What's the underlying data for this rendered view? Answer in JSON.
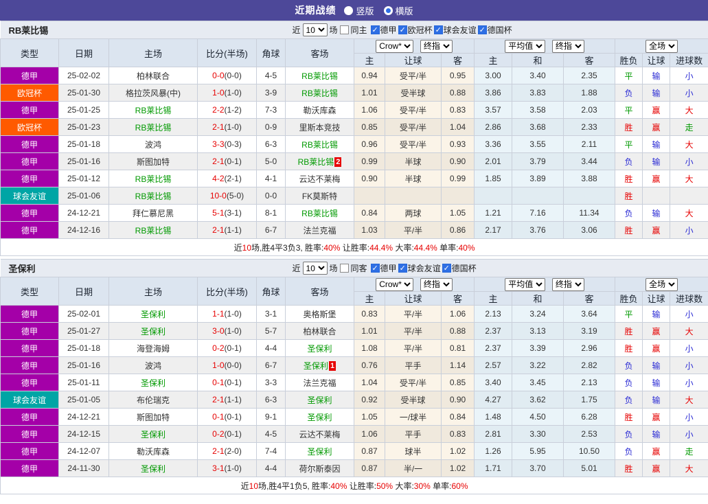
{
  "topbar": {
    "title": "近期战绩",
    "vertical_label": "竖版",
    "horizontal_label": "横版"
  },
  "controls": {
    "near_label": "近",
    "count": "10",
    "matches_label": "场"
  },
  "columns": {
    "main": [
      "类型",
      "日期",
      "主场",
      "比分(半场)",
      "角球",
      "客场"
    ],
    "sub": [
      "主",
      "让球",
      "客",
      "主",
      "和",
      "客",
      "胜负",
      "让球",
      "进球数"
    ],
    "dropdowns": {
      "crow": "Crow*",
      "final1": "终指",
      "avg": "平均值",
      "final2": "终指",
      "scope": "全场"
    }
  },
  "colors": {
    "accent_purple": "#4d4899",
    "league_purple": "#a400a8",
    "league_orange": "#ff5a00",
    "league_teal": "#00a5a5",
    "win_red": "#e60000",
    "lose_blue": "#2a2ad4",
    "draw_green": "#009900"
  },
  "tables": [
    {
      "team": "RB莱比锡",
      "same_label": "同主",
      "leagues": [
        "德甲",
        "欧冠杯",
        "球会友谊",
        "德国杯"
      ],
      "rows": [
        {
          "type": "德甲",
          "type_cls": "purple",
          "date": "25-02-02",
          "home": "柏林联合",
          "home_focus": false,
          "score": "0-0",
          "half": "(0-0)",
          "corner": "4-5",
          "away": "RB莱比锡",
          "away_focus": true,
          "badge": "",
          "c0": "0.94",
          "c1": "受平/半",
          "c2": "0.95",
          "a0": "3.00",
          "a1": "3.40",
          "a2": "2.35",
          "r0": "平",
          "k0": "g",
          "r1": "输",
          "k1": "b",
          "r2": "小",
          "k2": "b"
        },
        {
          "type": "欧冠杯",
          "type_cls": "orange",
          "date": "25-01-30",
          "home": "格拉茨风暴(中)",
          "home_focus": false,
          "score": "1-0",
          "half": "(1-0)",
          "corner": "3-9",
          "away": "RB莱比锡",
          "away_focus": true,
          "badge": "",
          "c0": "1.01",
          "c1": "受半球",
          "c2": "0.88",
          "a0": "3.86",
          "a1": "3.83",
          "a2": "1.88",
          "r0": "负",
          "k0": "b",
          "r1": "输",
          "k1": "b",
          "r2": "小",
          "k2": "b"
        },
        {
          "type": "德甲",
          "type_cls": "purple",
          "date": "25-01-25",
          "home": "RB莱比锡",
          "home_focus": true,
          "score": "2-2",
          "half": "(1-2)",
          "corner": "7-3",
          "away": "勒沃库森",
          "away_focus": false,
          "badge": "",
          "c0": "1.06",
          "c1": "受平/半",
          "c2": "0.83",
          "a0": "3.57",
          "a1": "3.58",
          "a2": "2.03",
          "r0": "平",
          "k0": "g",
          "r1": "赢",
          "k1": "r",
          "r2": "大",
          "k2": "r"
        },
        {
          "type": "欧冠杯",
          "type_cls": "orange",
          "date": "25-01-23",
          "home": "RB莱比锡",
          "home_focus": true,
          "score": "2-1",
          "half": "(1-0)",
          "corner": "0-9",
          "away": "里斯本竞技",
          "away_focus": false,
          "badge": "",
          "c0": "0.85",
          "c1": "受平/半",
          "c2": "1.04",
          "a0": "2.86",
          "a1": "3.68",
          "a2": "2.33",
          "r0": "胜",
          "k0": "r",
          "r1": "赢",
          "k1": "r",
          "r2": "走",
          "k2": "g"
        },
        {
          "type": "德甲",
          "type_cls": "purple",
          "date": "25-01-18",
          "home": "波鸿",
          "home_focus": false,
          "score": "3-3",
          "half": "(0-3)",
          "corner": "6-3",
          "away": "RB莱比锡",
          "away_focus": true,
          "badge": "",
          "c0": "0.96",
          "c1": "受平/半",
          "c2": "0.93",
          "a0": "3.36",
          "a1": "3.55",
          "a2": "2.11",
          "r0": "平",
          "k0": "g",
          "r1": "输",
          "k1": "b",
          "r2": "大",
          "k2": "r"
        },
        {
          "type": "德甲",
          "type_cls": "purple",
          "date": "25-01-16",
          "home": "斯图加特",
          "home_focus": false,
          "score": "2-1",
          "half": "(0-1)",
          "corner": "5-0",
          "away": "RB莱比锡",
          "away_focus": true,
          "badge": "2",
          "c0": "0.99",
          "c1": "半球",
          "c2": "0.90",
          "a0": "2.01",
          "a1": "3.79",
          "a2": "3.44",
          "r0": "负",
          "k0": "b",
          "r1": "输",
          "k1": "b",
          "r2": "小",
          "k2": "b"
        },
        {
          "type": "德甲",
          "type_cls": "purple",
          "date": "25-01-12",
          "home": "RB莱比锡",
          "home_focus": true,
          "score": "4-2",
          "half": "(2-1)",
          "corner": "4-1",
          "away": "云达不莱梅",
          "away_focus": false,
          "badge": "",
          "c0": "0.90",
          "c1": "半球",
          "c2": "0.99",
          "a0": "1.85",
          "a1": "3.89",
          "a2": "3.88",
          "r0": "胜",
          "k0": "r",
          "r1": "赢",
          "k1": "r",
          "r2": "大",
          "k2": "r"
        },
        {
          "type": "球会友谊",
          "type_cls": "teal",
          "date": "25-01-06",
          "home": "RB莱比锡",
          "home_focus": true,
          "score": "10-0",
          "half": "(5-0)",
          "corner": "0-0",
          "away": "FK莫斯特",
          "away_focus": false,
          "badge": "",
          "c0": "",
          "c1": "",
          "c2": "",
          "a0": "",
          "a1": "",
          "a2": "",
          "r0": "胜",
          "k0": "r",
          "r1": "",
          "k1": "",
          "r2": "",
          "k2": ""
        },
        {
          "type": "德甲",
          "type_cls": "purple",
          "date": "24-12-21",
          "home": "拜仁慕尼黑",
          "home_focus": false,
          "score": "5-1",
          "half": "(3-1)",
          "corner": "8-1",
          "away": "RB莱比锡",
          "away_focus": true,
          "badge": "",
          "c0": "0.84",
          "c1": "两球",
          "c2": "1.05",
          "a0": "1.21",
          "a1": "7.16",
          "a2": "11.34",
          "r0": "负",
          "k0": "b",
          "r1": "输",
          "k1": "b",
          "r2": "大",
          "k2": "r"
        },
        {
          "type": "德甲",
          "type_cls": "purple",
          "date": "24-12-16",
          "home": "RB莱比锡",
          "home_focus": true,
          "score": "2-1",
          "half": "(1-1)",
          "corner": "6-7",
          "away": "法兰克福",
          "away_focus": false,
          "badge": "",
          "c0": "1.03",
          "c1": "平/半",
          "c2": "0.86",
          "a0": "2.17",
          "a1": "3.76",
          "a2": "3.06",
          "r0": "胜",
          "k0": "r",
          "r1": "赢",
          "k1": "r",
          "r2": "小",
          "k2": "b"
        }
      ],
      "summary": [
        {
          "t": "近",
          "c": "k"
        },
        {
          "t": "10",
          "c": "r"
        },
        {
          "t": "场,胜4平3负3, 胜率:",
          "c": "k"
        },
        {
          "t": "40%",
          "c": "r"
        },
        {
          "t": " 让胜率:",
          "c": "k"
        },
        {
          "t": "44.4%",
          "c": "r"
        },
        {
          "t": " 大率:",
          "c": "k"
        },
        {
          "t": "44.4%",
          "c": "r"
        },
        {
          "t": " 单率:",
          "c": "k"
        },
        {
          "t": "40%",
          "c": "r"
        }
      ]
    },
    {
      "team": "圣保利",
      "same_label": "同客",
      "leagues": [
        "德甲",
        "球会友谊",
        "德国杯"
      ],
      "rows": [
        {
          "type": "德甲",
          "type_cls": "purple",
          "date": "25-02-01",
          "home": "圣保利",
          "home_focus": true,
          "score": "1-1",
          "half": "(1-0)",
          "corner": "3-1",
          "away": "奥格斯堡",
          "away_focus": false,
          "badge": "",
          "c0": "0.83",
          "c1": "平/半",
          "c2": "1.06",
          "a0": "2.13",
          "a1": "3.24",
          "a2": "3.64",
          "r0": "平",
          "k0": "g",
          "r1": "输",
          "k1": "b",
          "r2": "小",
          "k2": "b"
        },
        {
          "type": "德甲",
          "type_cls": "purple",
          "date": "25-01-27",
          "home": "圣保利",
          "home_focus": true,
          "score": "3-0",
          "half": "(1-0)",
          "corner": "5-7",
          "away": "柏林联合",
          "away_focus": false,
          "badge": "",
          "c0": "1.01",
          "c1": "平/半",
          "c2": "0.88",
          "a0": "2.37",
          "a1": "3.13",
          "a2": "3.19",
          "r0": "胜",
          "k0": "r",
          "r1": "赢",
          "k1": "r",
          "r2": "大",
          "k2": "r"
        },
        {
          "type": "德甲",
          "type_cls": "purple",
          "date": "25-01-18",
          "home": "海登海姆",
          "home_focus": false,
          "score": "0-2",
          "half": "(0-1)",
          "corner": "4-4",
          "away": "圣保利",
          "away_focus": true,
          "badge": "",
          "c0": "1.08",
          "c1": "平/半",
          "c2": "0.81",
          "a0": "2.37",
          "a1": "3.39",
          "a2": "2.96",
          "r0": "胜",
          "k0": "r",
          "r1": "赢",
          "k1": "r",
          "r2": "小",
          "k2": "b"
        },
        {
          "type": "德甲",
          "type_cls": "purple",
          "date": "25-01-16",
          "home": "波鸿",
          "home_focus": false,
          "score": "1-0",
          "half": "(0-0)",
          "corner": "6-7",
          "away": "圣保利",
          "away_focus": true,
          "badge": "1",
          "c0": "0.76",
          "c1": "平手",
          "c2": "1.14",
          "a0": "2.57",
          "a1": "3.22",
          "a2": "2.82",
          "r0": "负",
          "k0": "b",
          "r1": "输",
          "k1": "b",
          "r2": "小",
          "k2": "b"
        },
        {
          "type": "德甲",
          "type_cls": "purple",
          "date": "25-01-11",
          "home": "圣保利",
          "home_focus": true,
          "score": "0-1",
          "half": "(0-1)",
          "corner": "3-3",
          "away": "法兰克福",
          "away_focus": false,
          "badge": "",
          "c0": "1.04",
          "c1": "受平/半",
          "c2": "0.85",
          "a0": "3.40",
          "a1": "3.45",
          "a2": "2.13",
          "r0": "负",
          "k0": "b",
          "r1": "输",
          "k1": "b",
          "r2": "小",
          "k2": "b"
        },
        {
          "type": "球会友谊",
          "type_cls": "teal",
          "date": "25-01-05",
          "home": "布伦瑞克",
          "home_focus": false,
          "score": "2-1",
          "half": "(1-1)",
          "corner": "6-3",
          "away": "圣保利",
          "away_focus": true,
          "badge": "",
          "c0": "0.92",
          "c1": "受半球",
          "c2": "0.90",
          "a0": "4.27",
          "a1": "3.62",
          "a2": "1.75",
          "r0": "负",
          "k0": "b",
          "r1": "输",
          "k1": "b",
          "r2": "大",
          "k2": "r"
        },
        {
          "type": "德甲",
          "type_cls": "purple",
          "date": "24-12-21",
          "home": "斯图加特",
          "home_focus": false,
          "score": "0-1",
          "half": "(0-1)",
          "corner": "9-1",
          "away": "圣保利",
          "away_focus": true,
          "badge": "",
          "c0": "1.05",
          "c1": "一/球半",
          "c2": "0.84",
          "a0": "1.48",
          "a1": "4.50",
          "a2": "6.28",
          "r0": "胜",
          "k0": "r",
          "r1": "赢",
          "k1": "r",
          "r2": "小",
          "k2": "b"
        },
        {
          "type": "德甲",
          "type_cls": "purple",
          "date": "24-12-15",
          "home": "圣保利",
          "home_focus": true,
          "score": "0-2",
          "half": "(0-1)",
          "corner": "4-5",
          "away": "云达不莱梅",
          "away_focus": false,
          "badge": "",
          "c0": "1.06",
          "c1": "平手",
          "c2": "0.83",
          "a0": "2.81",
          "a1": "3.30",
          "a2": "2.53",
          "r0": "负",
          "k0": "b",
          "r1": "输",
          "k1": "b",
          "r2": "小",
          "k2": "b"
        },
        {
          "type": "德甲",
          "type_cls": "purple",
          "date": "24-12-07",
          "home": "勒沃库森",
          "home_focus": false,
          "score": "2-1",
          "half": "(2-0)",
          "corner": "7-4",
          "away": "圣保利",
          "away_focus": true,
          "badge": "",
          "c0": "0.87",
          "c1": "球半",
          "c2": "1.02",
          "a0": "1.26",
          "a1": "5.95",
          "a2": "10.50",
          "r0": "负",
          "k0": "b",
          "r1": "赢",
          "k1": "r",
          "r2": "走",
          "k2": "g"
        },
        {
          "type": "德甲",
          "type_cls": "purple",
          "date": "24-11-30",
          "home": "圣保利",
          "home_focus": true,
          "score": "3-1",
          "half": "(1-0)",
          "corner": "4-4",
          "away": "荷尔斯泰因",
          "away_focus": false,
          "badge": "",
          "c0": "0.87",
          "c1": "半/一",
          "c2": "1.02",
          "a0": "1.71",
          "a1": "3.70",
          "a2": "5.01",
          "r0": "胜",
          "k0": "r",
          "r1": "赢",
          "k1": "r",
          "r2": "大",
          "k2": "r"
        }
      ],
      "summary": [
        {
          "t": "近",
          "c": "k"
        },
        {
          "t": "10",
          "c": "r"
        },
        {
          "t": "场,胜4平1负5, 胜率:",
          "c": "k"
        },
        {
          "t": "40%",
          "c": "r"
        },
        {
          "t": " 让胜率:",
          "c": "k"
        },
        {
          "t": "50%",
          "c": "r"
        },
        {
          "t": " 大率:",
          "c": "k"
        },
        {
          "t": "30%",
          "c": "r"
        },
        {
          "t": " 单率:",
          "c": "k"
        },
        {
          "t": "60%",
          "c": "r"
        }
      ]
    }
  ]
}
